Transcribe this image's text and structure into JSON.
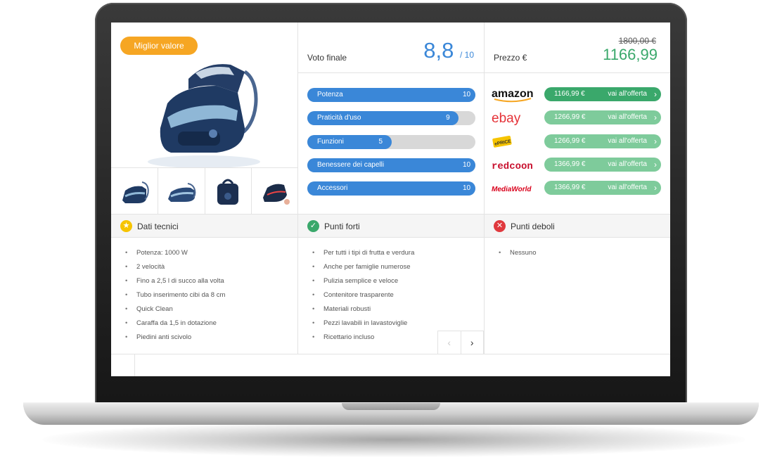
{
  "badge": "Miglior valore",
  "rating": {
    "label": "Voto finale",
    "score": "8,8",
    "out_of": "/ 10"
  },
  "price": {
    "label": "Prezzo €",
    "old": "1800,00 €",
    "current": "1166,99"
  },
  "scores": [
    {
      "label": "Potenza",
      "value": "10",
      "fraction": 1.0
    },
    {
      "label": "Praticità d'uso",
      "value": "9",
      "fraction": 0.9
    },
    {
      "label": "Funzioni",
      "value": "5",
      "fraction": 0.5
    },
    {
      "label": "Benessere dei capelli",
      "value": "10",
      "fraction": 1.0
    },
    {
      "label": "Accessori",
      "value": "10",
      "fraction": 1.0
    }
  ],
  "shops": [
    {
      "name": "amazon",
      "price": "1166,99 €",
      "cta": "vai all'offerta"
    },
    {
      "name": "ebay",
      "price": "1266,99 €",
      "cta": "vai all'offerta"
    },
    {
      "name": "ePRICE",
      "price": "1266,99 €",
      "cta": "vai all'offerta"
    },
    {
      "name": "redcoon",
      "price": "1366,99 €",
      "cta": "vai all'offerta"
    },
    {
      "name": "MediaWorld",
      "price": "1366,99 €",
      "cta": "vai all'offerta"
    }
  ],
  "colors": {
    "blue": "#3a87d8",
    "green": "#3aa86b",
    "light_green": "#7ecb9b",
    "orange": "#f6a623",
    "red": "#e0393e"
  },
  "panels": {
    "tech": {
      "title": "Dati tecnici",
      "icon": "star-icon",
      "items": [
        "Potenza: 1000 W",
        "2 velocità",
        "Fino a 2,5 l di succo alla volta",
        "Tubo inserimento cibi da 8 cm",
        "Quick Clean",
        "Caraffa da 1,5 in dotazione",
        "Piedini anti scivolo"
      ]
    },
    "pros": {
      "title": "Punti forti",
      "icon": "check-icon",
      "items": [
        "Per tutti i tipi di frutta e verdura",
        "Anche per famiglie numerose",
        "Pulizia semplice e veloce",
        "Contenitore trasparente",
        "Materiali robusti",
        "Pezzi lavabili in lavastoviglie",
        "Ricettario incluso"
      ]
    },
    "cons": {
      "title": "Punti deboli",
      "icon": "cross-icon",
      "items": [
        "Nessuno"
      ]
    }
  }
}
